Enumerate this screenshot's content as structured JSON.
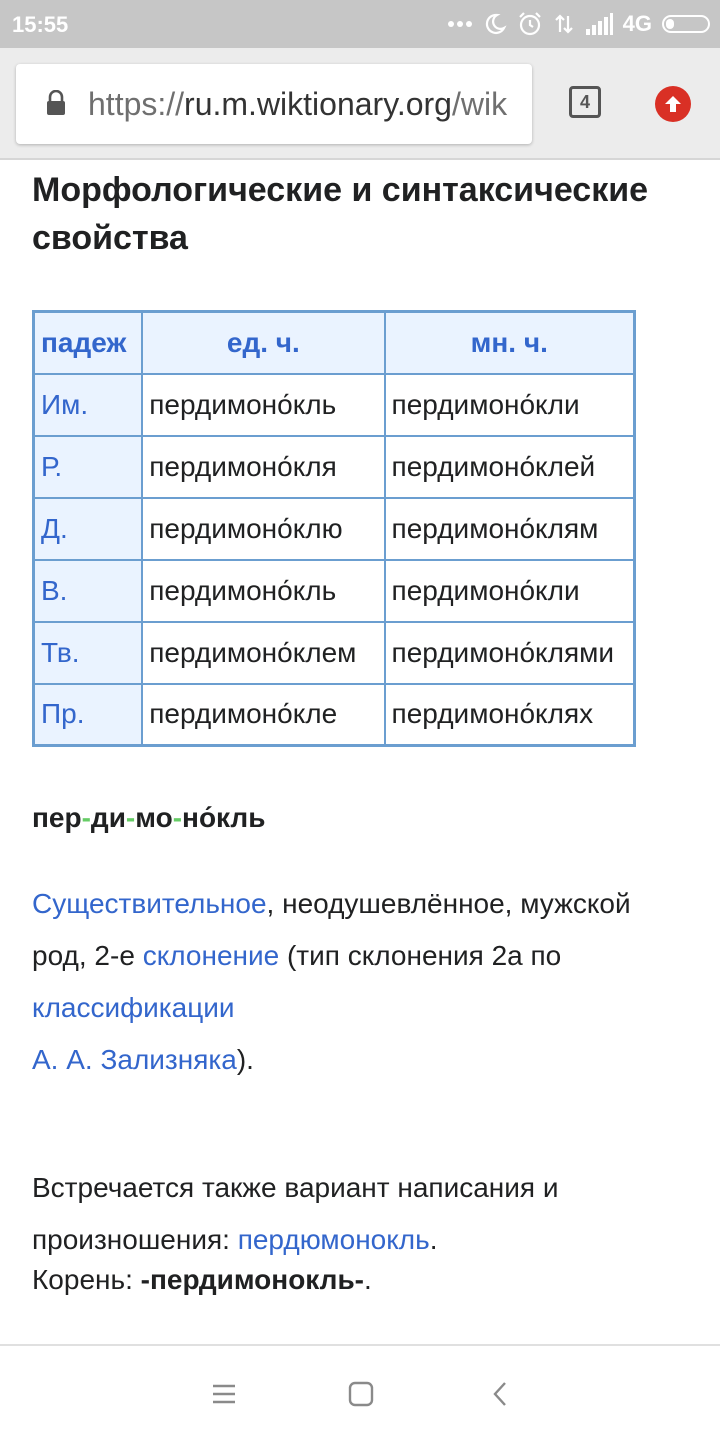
{
  "status_bar": {
    "time": "15:55",
    "network": "4G",
    "icons": [
      "more-dots-icon",
      "moon-icon",
      "alarm-icon",
      "data-transfer-icon",
      "signal-icon",
      "battery-icon"
    ]
  },
  "browser": {
    "url_prefix": "https://",
    "url_host": "ru.m.wiktionary.org",
    "url_path": "/wik",
    "tab_count": "4",
    "accent_color": "#d93025"
  },
  "article": {
    "section_heading": "Морфологические и синтаксические свойства",
    "table": {
      "headers": [
        "падеж",
        "ед. ч.",
        "мн. ч."
      ],
      "rows": [
        {
          "case": "Им.",
          "singular": "пердимоно́кль",
          "plural": "пердимоно́кли"
        },
        {
          "case": "Р.",
          "singular": "пердимоно́кля",
          "plural": "пердимоно́клей"
        },
        {
          "case": "Д.",
          "singular": "пердимоно́клю",
          "plural": "пердимоно́клям"
        },
        {
          "case": "В.",
          "singular": "пердимоно́кль",
          "plural": "пердимоно́кли"
        },
        {
          "case": "Тв.",
          "singular": "пердимоно́клем",
          "plural": "пердимоно́клями"
        },
        {
          "case": "Пр.",
          "singular": "пердимоно́кле",
          "plural": "пердимоно́клях"
        }
      ]
    },
    "syllables": [
      "пер",
      "ди",
      "мо",
      "но́кль"
    ],
    "syllable_separator": "-",
    "paragraph1": {
      "link_noun": "Существительное",
      "text1": ", неодушевлённое, мужской род, 2-е ",
      "link_declension": "склонение",
      "text2": " (тип склонения 2a по ",
      "link_classification": "классификации",
      "link_zaliznyak": "А. А. Зализняка",
      "text3": ")."
    },
    "paragraph2": {
      "text": "Встречается также вариант написания и произношения: ",
      "link_variant": "пердюмонокль",
      "end": "."
    },
    "paragraph3": {
      "label": "Корень: ",
      "root": "-пердимонокль-",
      "end": "."
    },
    "colors": {
      "link": "#3366cc",
      "table_border": "#6b9ed0",
      "table_header_bg": "#eaf3ff",
      "hyphen": "#66cc66"
    }
  },
  "nav_bar": {
    "icons": [
      "menu-icon",
      "home-square-icon",
      "back-chevron-icon"
    ]
  }
}
